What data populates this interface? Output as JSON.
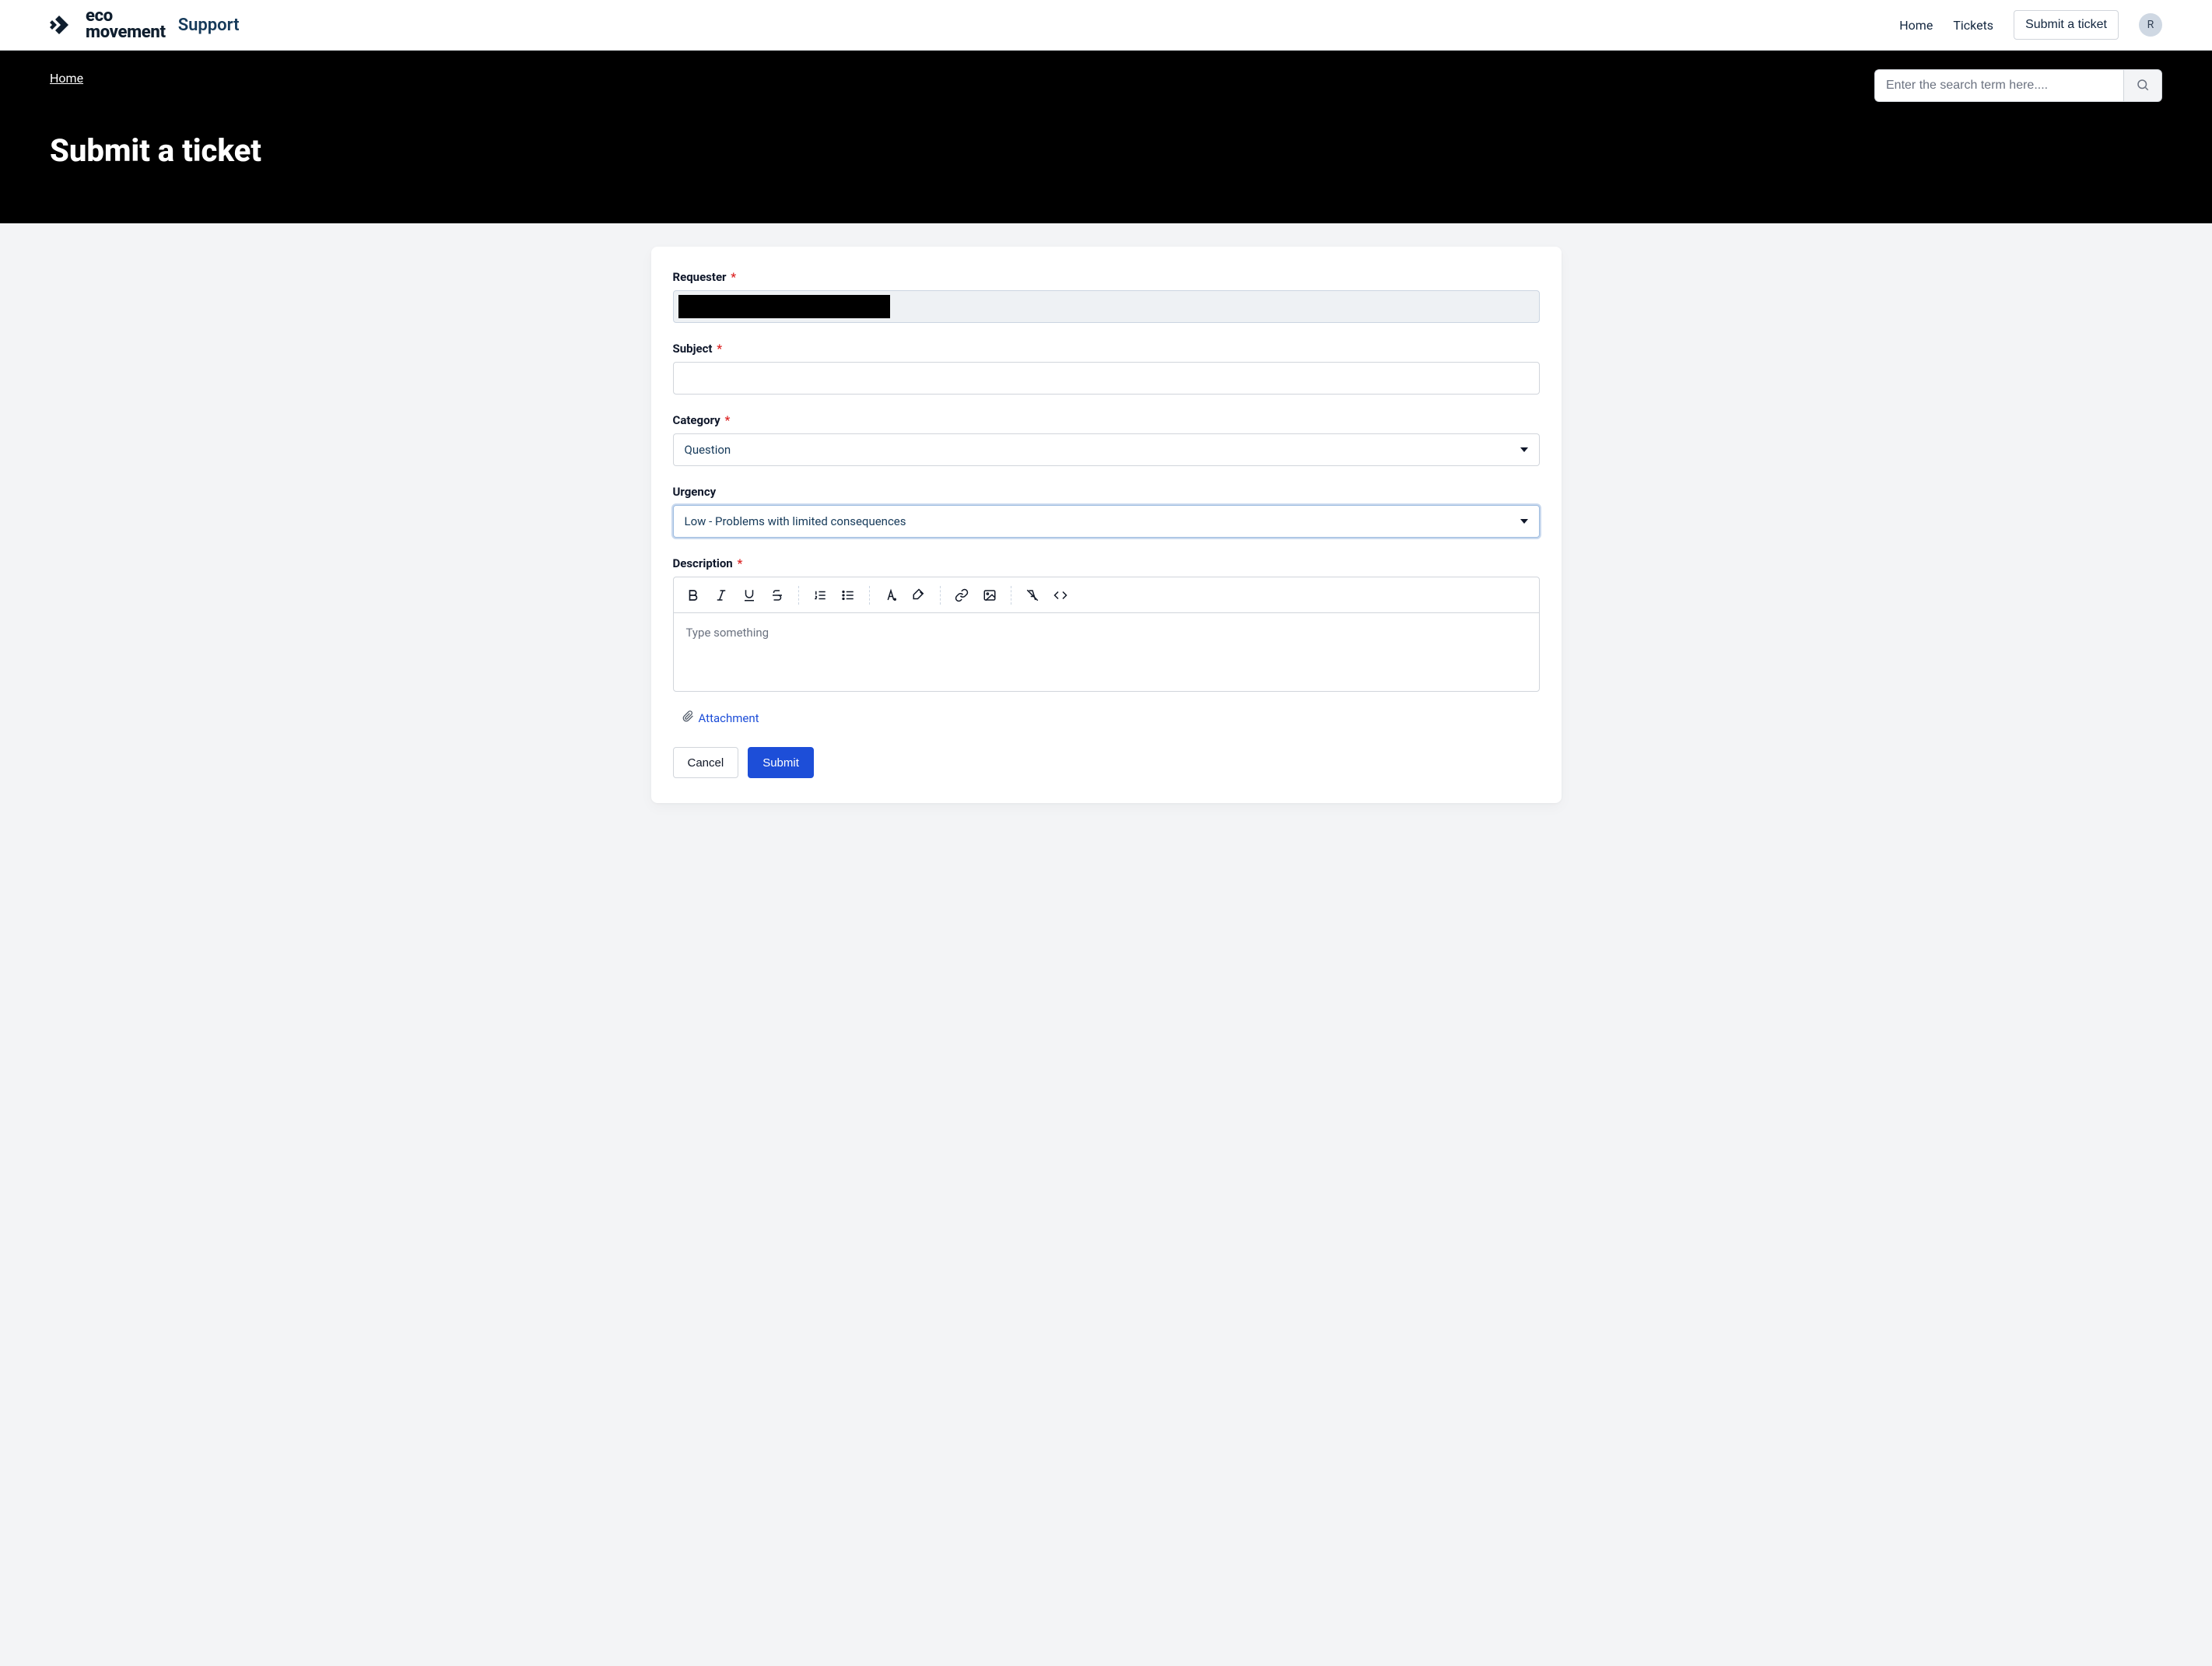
{
  "header": {
    "logo_line1": "eco",
    "logo_line2": "movement",
    "logo_support": "Support",
    "nav_home": "Home",
    "nav_tickets": "Tickets",
    "nav_submit": "Submit a ticket",
    "avatar_initial": "R"
  },
  "hero": {
    "breadcrumb_home": "Home",
    "search_placeholder": "Enter the search term here....",
    "title": "Submit a ticket"
  },
  "form": {
    "requester_label": "Requester",
    "subject_label": "Subject",
    "subject_value": "",
    "category_label": "Category",
    "category_value": "Question",
    "urgency_label": "Urgency",
    "urgency_value": "Low - Problems with limited consequences",
    "description_label": "Description",
    "description_placeholder": "Type something",
    "attachment_label": "Attachment",
    "cancel_label": "Cancel",
    "submit_label": "Submit",
    "required_mark": "*"
  }
}
